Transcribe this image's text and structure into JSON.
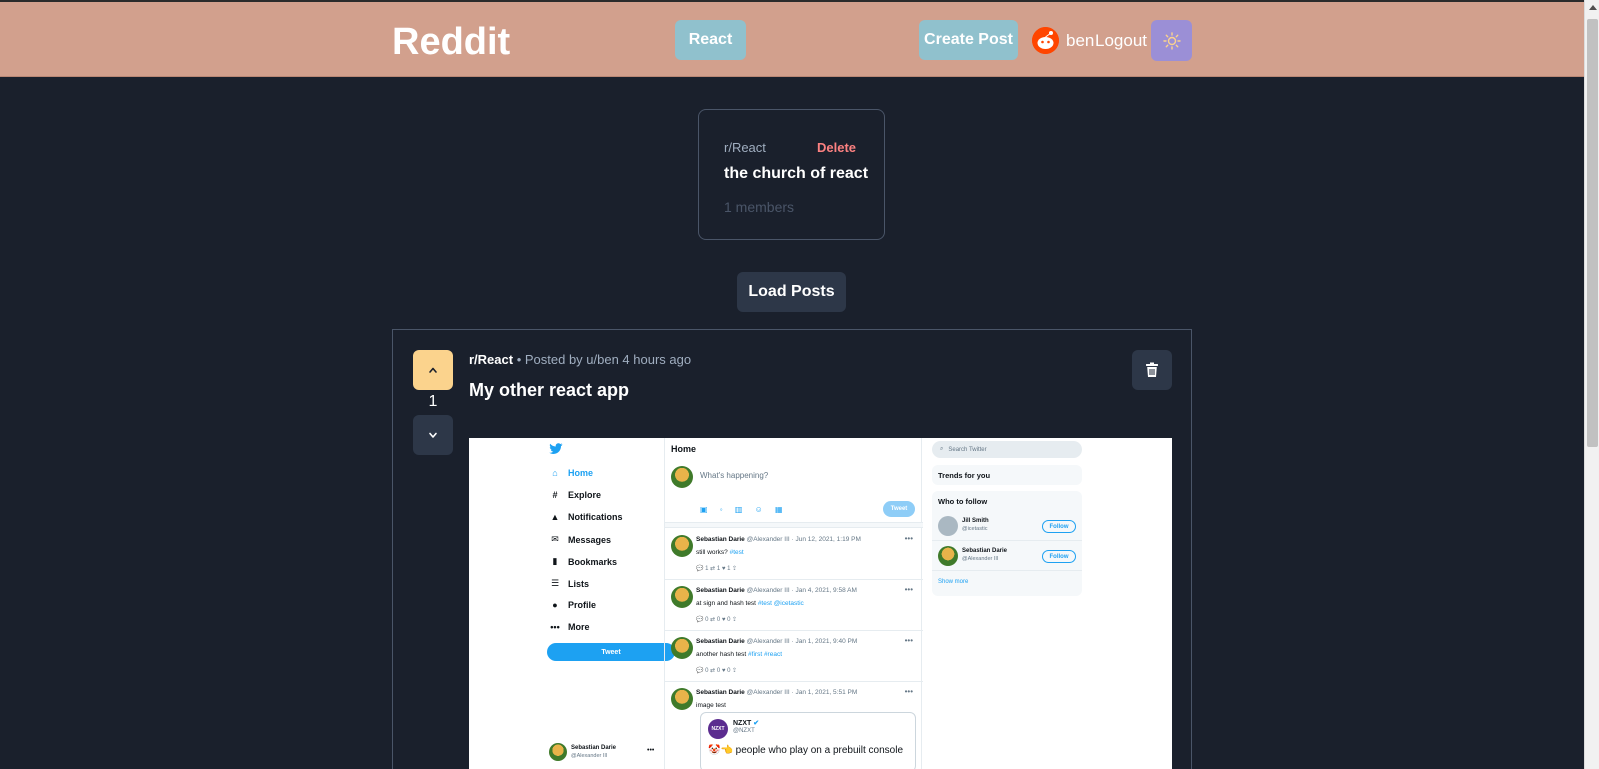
{
  "navbar": {
    "brand": "Reddit",
    "react_button": "React",
    "create_post_button": "Create Post",
    "username": "ben",
    "logout": "Logout",
    "theme_icon": "sun-icon"
  },
  "community": {
    "name": "r/React",
    "delete": "Delete",
    "description": "the church of react",
    "members": "1 members"
  },
  "load_posts": "Load Posts",
  "post": {
    "subreddit": "r/React",
    "meta": "• Posted by u/ben 4 hours ago",
    "title": "My other react app",
    "votes": "1"
  },
  "screenshot": {
    "sidebar": [
      "Home",
      "Explore",
      "Notifications",
      "Messages",
      "Bookmarks",
      "Lists",
      "Profile",
      "More"
    ],
    "sidebar_icons": [
      "home-icon",
      "hash-icon",
      "bell-icon",
      "mail-icon",
      "bookmark-icon",
      "list-icon",
      "person-icon",
      "more-icon"
    ],
    "tweet_button": "Tweet",
    "account_name": "Sebastian Darie",
    "account_handle": "@Alexander III",
    "feed_title": "Home",
    "compose_placeholder": "What's happening?",
    "compose_button": "Tweet",
    "tweets": [
      {
        "name": "Sebastian Darie",
        "handle": "@Alexander III · Jun 12, 2021, 1:19 PM",
        "text": "still works?",
        "tags": "#test",
        "actions": "💬 1        ⇄ 1        ♥ 1        ⇪"
      },
      {
        "name": "Sebastian Darie",
        "handle": "@Alexander III · Jan 4, 2021, 9:58 AM",
        "text": "at sign and hash test",
        "tags": "#test @icetastic",
        "actions": "💬 0        ⇄ 0        ♥ 0        ⇪"
      },
      {
        "name": "Sebastian Darie",
        "handle": "@Alexander III · Jan 1, 2021, 9:40 PM",
        "text": "another hash test",
        "tags": "#first #react",
        "actions": "💬 0        ⇄ 0        ♥ 0        ⇪"
      },
      {
        "name": "Sebastian Darie",
        "handle": "@Alexander III · Jan 1, 2021, 5:51 PM",
        "text": "image test",
        "tags": "",
        "actions": ""
      }
    ],
    "embed_name": "NZXT",
    "embed_handle": "@NZXT",
    "embed_text": "🤡👈 people who play on a prebuilt console",
    "search_placeholder": "Search Twitter",
    "trends_title": "Trends for you",
    "follow_title": "Who to follow",
    "follow": [
      {
        "name": "Jill Smith",
        "handle": "@icetastic",
        "button": "Follow"
      },
      {
        "name": "Sebastian Darie",
        "handle": "@Alexander III",
        "button": "Follow"
      }
    ],
    "show_more": "Show more"
  },
  "colors": {
    "navbar": "#d2a08d",
    "background": "#1a202c",
    "button_teal": "#90c1cd",
    "theme_button": "#9b8fd6",
    "upvote": "#fbd38d",
    "delete": "#fc8181"
  }
}
